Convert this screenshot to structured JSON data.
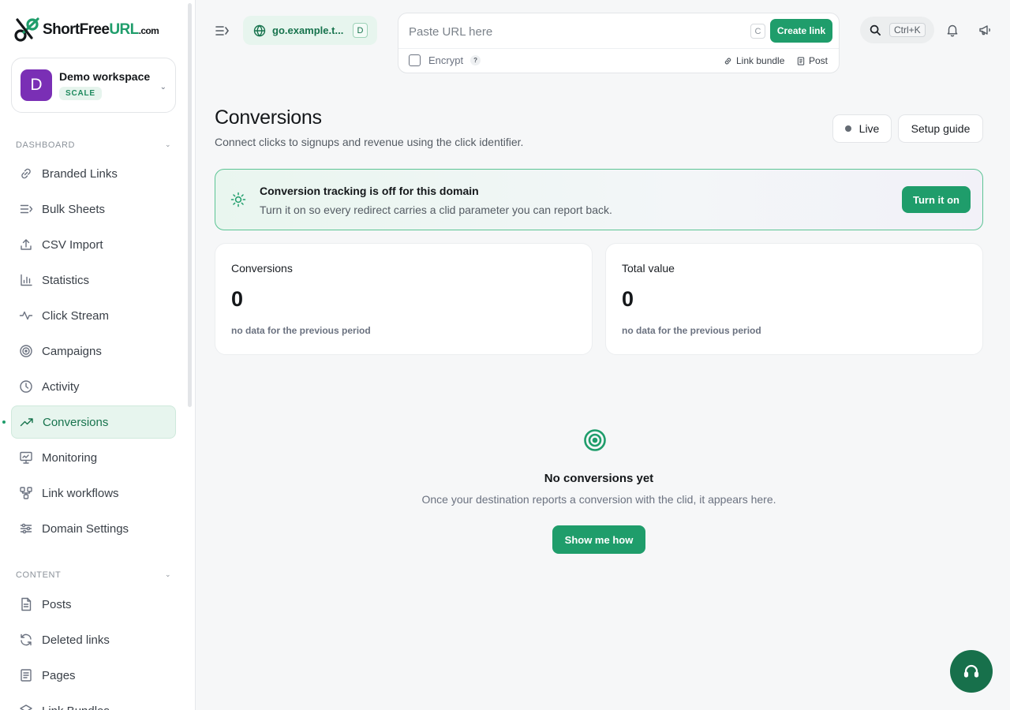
{
  "brand": {
    "name_prefix": "ShortFree",
    "name_url": "URL",
    "name_suffix": ".com"
  },
  "workspace": {
    "initial": "D",
    "name": "Demo workspace",
    "plan": "SCALE"
  },
  "sidebar": {
    "dashboard_label": "DASHBOARD",
    "content_label": "CONTENT",
    "dashboard_items": [
      {
        "label": "Branded Links",
        "icon": "link-icon"
      },
      {
        "label": "Bulk Sheets",
        "icon": "list-icon"
      },
      {
        "label": "CSV Import",
        "icon": "upload-icon"
      },
      {
        "label": "Statistics",
        "icon": "bar-chart-icon"
      },
      {
        "label": "Click Stream",
        "icon": "activity-icon"
      },
      {
        "label": "Campaigns",
        "icon": "target-icon"
      },
      {
        "label": "Activity",
        "icon": "clock-icon"
      },
      {
        "label": "Conversions",
        "icon": "trending-up-icon",
        "active": true
      },
      {
        "label": "Monitoring",
        "icon": "monitor-icon"
      },
      {
        "label": "Link workflows",
        "icon": "workflow-icon"
      },
      {
        "label": "Domain Settings",
        "icon": "sliders-icon"
      }
    ],
    "content_items": [
      {
        "label": "Posts",
        "icon": "document-icon"
      },
      {
        "label": "Deleted links",
        "icon": "refresh-icon"
      },
      {
        "label": "Pages",
        "icon": "page-icon"
      },
      {
        "label": "Link Bundles",
        "icon": "layers-icon"
      }
    ]
  },
  "topbar": {
    "domain": "go.example.t...",
    "domain_key": "D",
    "url_placeholder": "Paste URL here",
    "url_key": "C",
    "create_label": "Create link",
    "encrypt_label": "Encrypt",
    "help_glyph": "?",
    "link_bundle_label": "Link bundle",
    "post_label": "Post",
    "search_shortcut": "Ctrl+K"
  },
  "page": {
    "title": "Conversions",
    "subtitle": "Connect clicks to signups and revenue using the click identifier.",
    "live_label": "Live",
    "guide_label": "Setup guide"
  },
  "banner": {
    "title": "Conversion tracking is off for this domain",
    "text": "Turn it on so every redirect carries a clid parameter you can report back.",
    "button": "Turn it on"
  },
  "stats": [
    {
      "label": "Conversions",
      "value": "0",
      "note": "no data for the previous period"
    },
    {
      "label": "Total value",
      "value": "0",
      "note": "no data for the previous period"
    }
  ],
  "empty": {
    "title": "No conversions yet",
    "text": "Once your destination reports a conversion with the clid, it appears here.",
    "button": "Show me how"
  },
  "colors": {
    "accent": "#1f9d6b",
    "accent_dark": "#17704b",
    "avatar": "#7a2fb5"
  }
}
